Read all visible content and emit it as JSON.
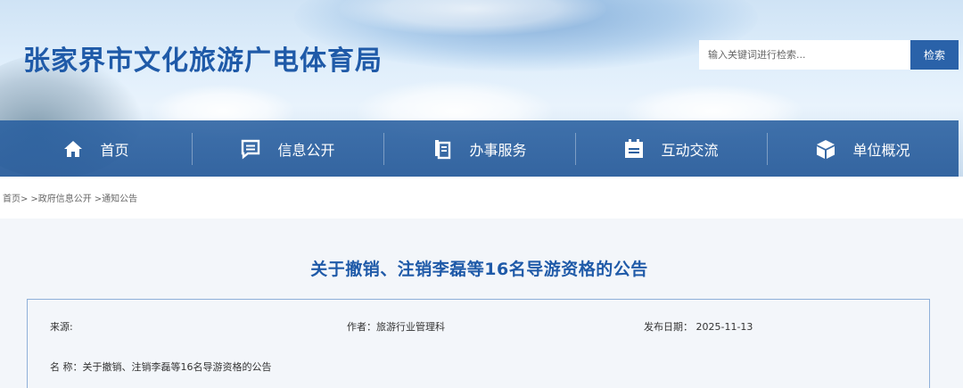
{
  "header": {
    "site_title": "张家界市文化旅游广电体育局",
    "search_placeholder": "输入关键词进行检索...",
    "search_button": "检索"
  },
  "nav": {
    "items": [
      {
        "label": "首页",
        "icon": "home-icon"
      },
      {
        "label": "信息公开",
        "icon": "message-icon"
      },
      {
        "label": "办事服务",
        "icon": "document-icon"
      },
      {
        "label": "互动交流",
        "icon": "calendar-icon"
      },
      {
        "label": "单位概况",
        "icon": "cube-icon"
      }
    ]
  },
  "breadcrumb": {
    "items": [
      "首页>",
      ">政府信息公开",
      ">通知公告"
    ]
  },
  "article": {
    "title": "关于撤销、注销李磊等16名导游资格的公告",
    "source_label": "来源:",
    "author": "作者：旅游行业管理科",
    "publish_date": "发布日期：  2025-11-13",
    "name": "名  称：关于撤销、注销李磊等16名导游资格的公告"
  },
  "colors": {
    "brand_blue": "#1f5aa8",
    "nav_blue": "#285fa0",
    "search_button": "#2a62a9"
  }
}
